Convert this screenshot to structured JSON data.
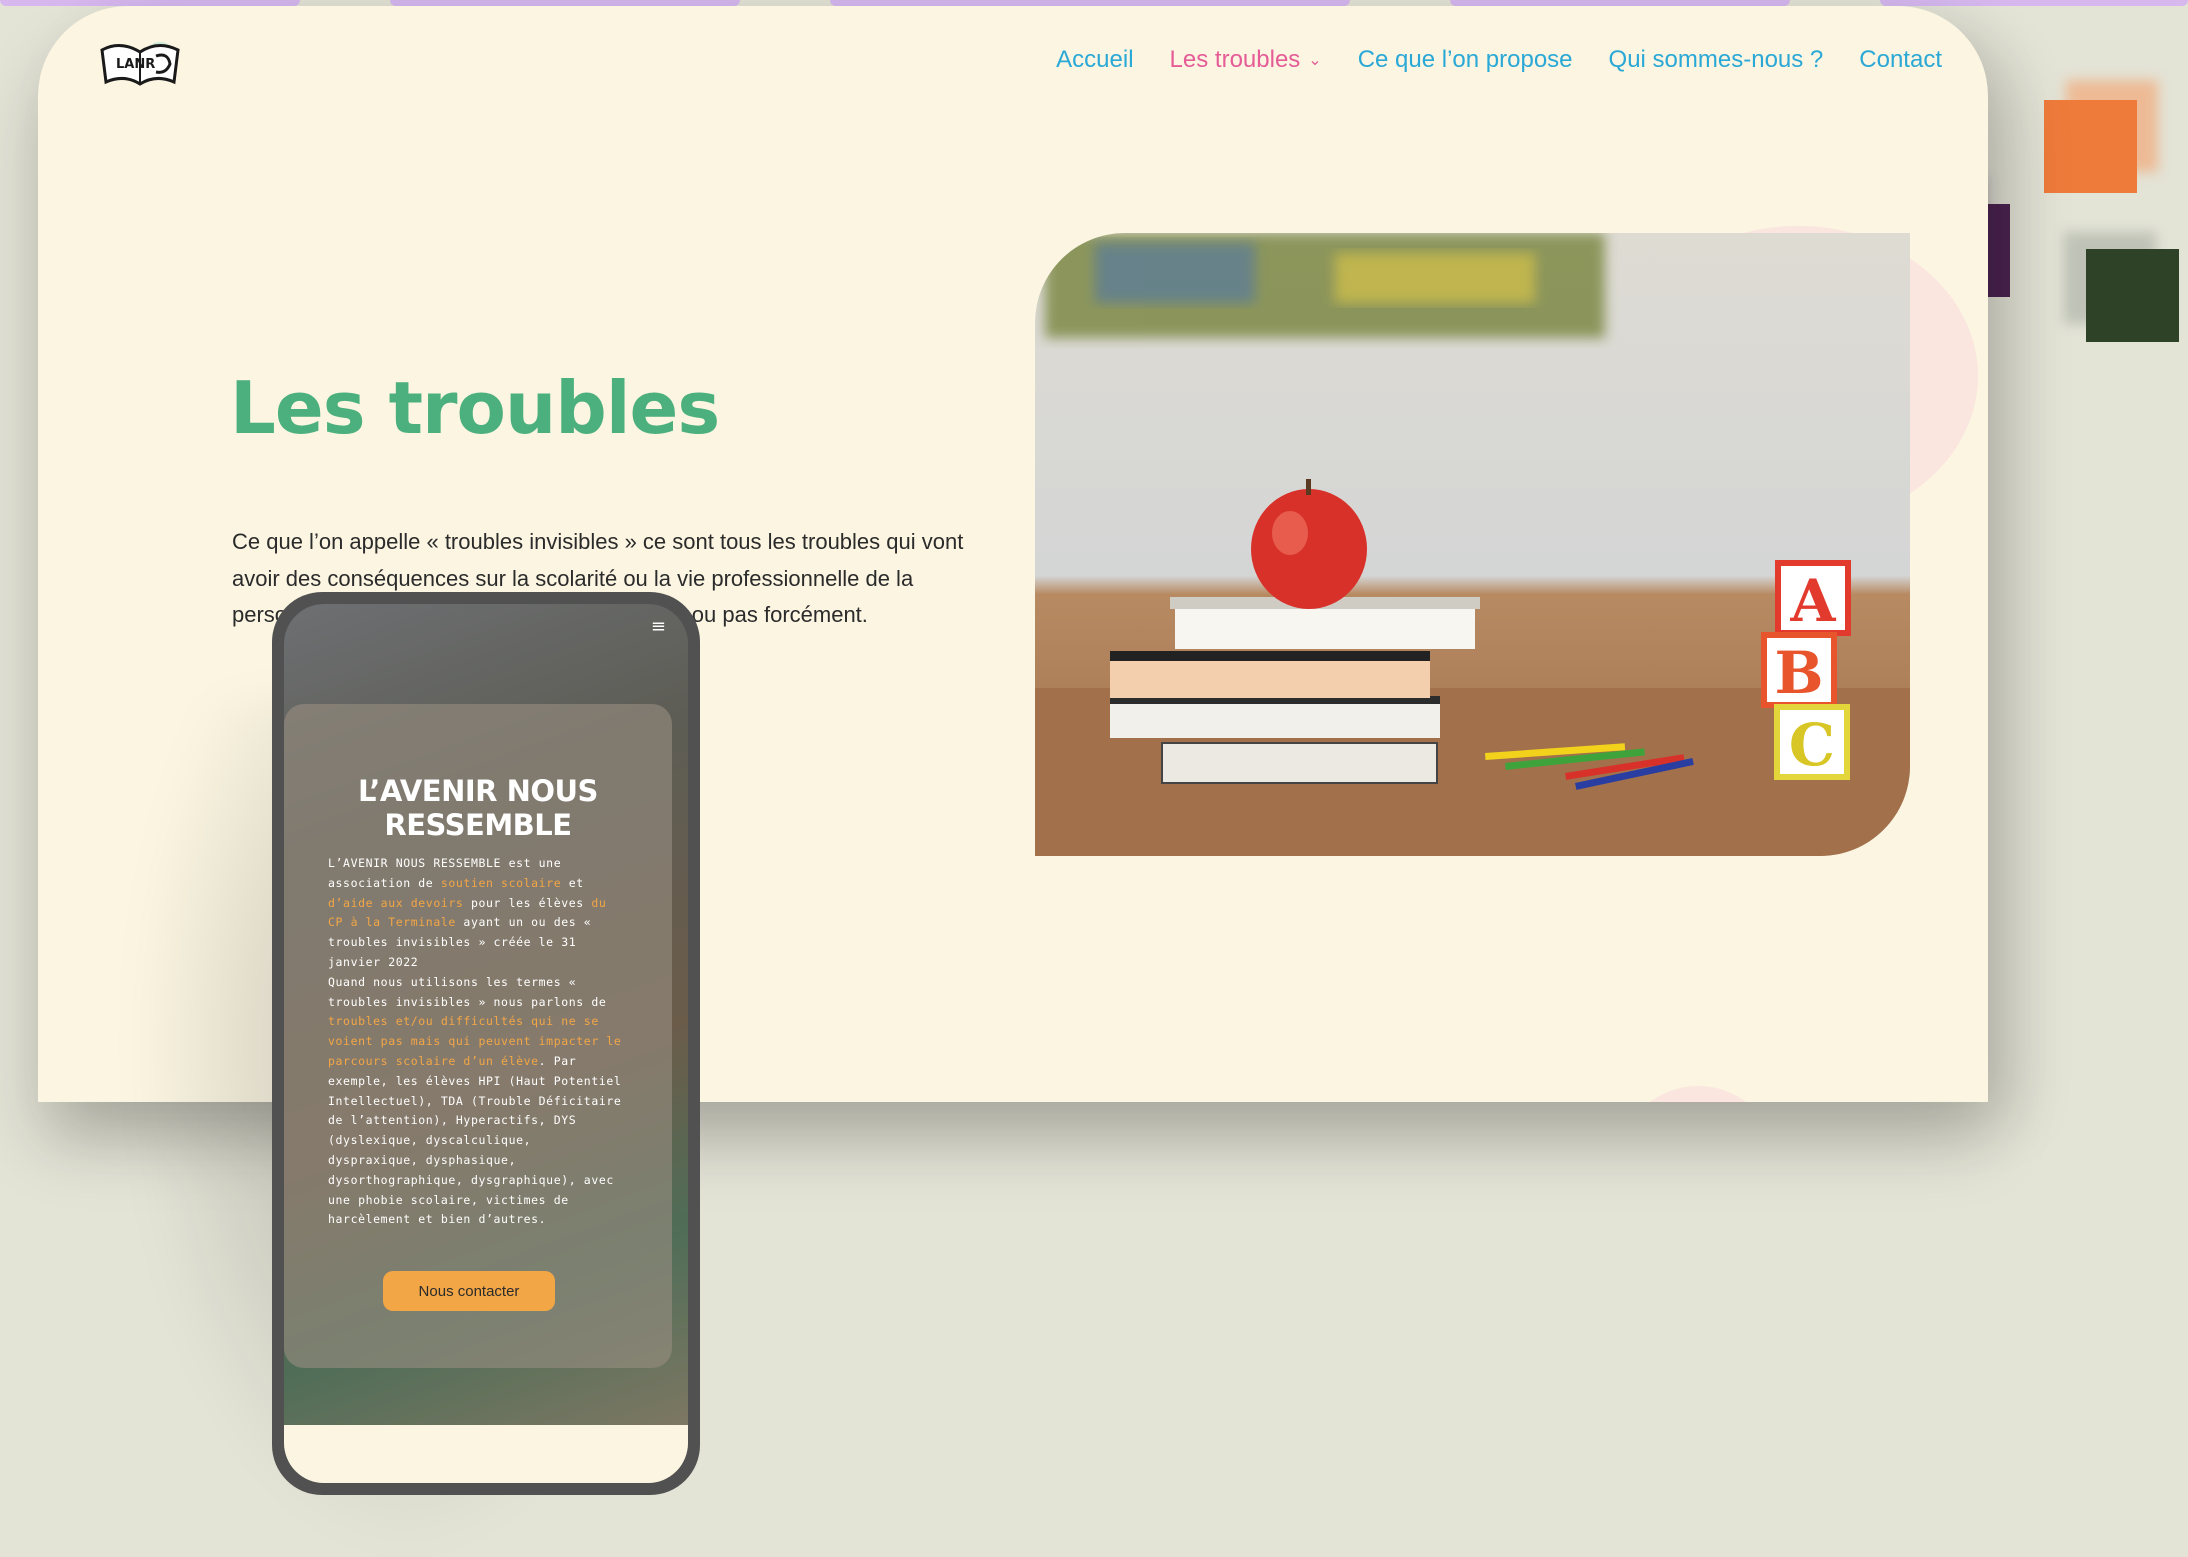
{
  "colors": {
    "background": "#e3e3d6",
    "page": "#fbf5e2",
    "nav_link": "#2aa8d6",
    "nav_active": "#e55c97",
    "title_green": "#4bb07d",
    "accent_orange": "#f3a646",
    "square_orange": "#ef7b3b",
    "square_purple": "#4d2452",
    "square_green": "#2e4227"
  },
  "logo": {
    "text": "LANR",
    "icon": "open-book-icon"
  },
  "nav": {
    "items": [
      {
        "label": "Accueil"
      },
      {
        "label": "Les troubles",
        "active": true,
        "icon": "chevron-down-icon"
      },
      {
        "label": "Ce que l’on propose"
      },
      {
        "label": "Qui sommes-nous ?"
      },
      {
        "label": "Contact"
      }
    ]
  },
  "hero": {
    "title": "Les troubles",
    "text": "Ce que l’on appelle « troubles invisibles » ce sont tous les troubles qui vont avoir des conséquences sur la scolarité ou la vie professionnelle de la personne. Il peut y avoir un nom sur ce trouble ou pas forcément."
  },
  "photo": {
    "blocks": [
      "A",
      "B",
      "C"
    ]
  },
  "phone": {
    "menu_icon": "≡",
    "title": "L’AVENIR NOUS RESSEMBLE",
    "text_parts": [
      {
        "t": "L’AVENIR NOUS RESSEMBLE est une association de ",
        "hl": false
      },
      {
        "t": "soutien scolaire",
        "hl": true
      },
      {
        "t": " et ",
        "hl": false
      },
      {
        "t": "d’aide aux devoirs",
        "hl": true
      },
      {
        "t": " pour les élèves ",
        "hl": false
      },
      {
        "t": "du CP à la Terminale",
        "hl": true
      },
      {
        "t": " ayant un ou des « troubles invisibles » créée le 31 janvier 2022",
        "hl": false
      },
      {
        "t": "\nQuand nous utilisons les termes « troubles invisibles » nous parlons de ",
        "hl": false
      },
      {
        "t": "troubles et/ou difficultés qui ne se voient pas mais qui peuvent impacter le parcours scolaire d’un élève",
        "hl": true
      },
      {
        "t": ". Par exemple, les élèves HPI (Haut Potentiel Intellectuel), TDA (Trouble Déficitaire de l’attention), Hyperactifs, DYS (dyslexique, dyscalculique, dyspraxique, dysphasique, dysorthographique, dysgraphique), avec une phobie scolaire, victimes de harcèlement et bien d’autres.",
        "hl": false
      }
    ],
    "button_label": "Nous contacter"
  }
}
